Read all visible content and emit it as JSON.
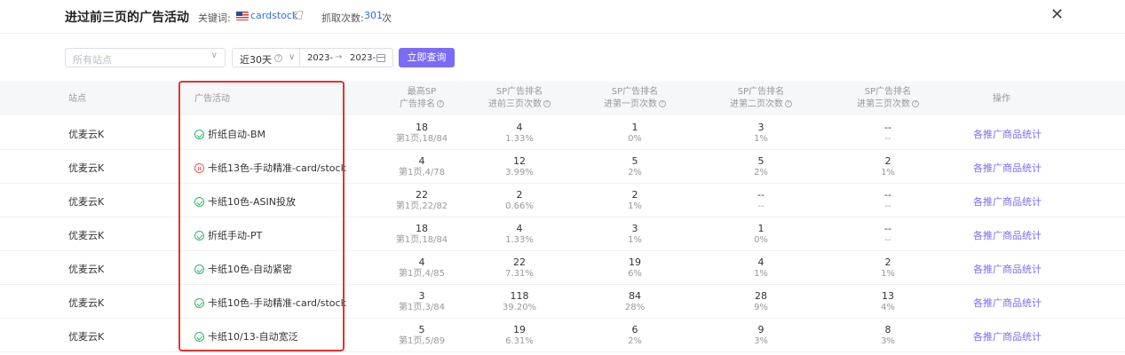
{
  "header": {
    "title": "进过前三页的广告活动",
    "keyword_label": "关键词:",
    "keyword_value": "cardstock",
    "count_label": "抓取次数:",
    "count_value": "301",
    "count_unit": "次"
  },
  "filters": {
    "site_placeholder": "所有站点",
    "range_selected": "近30天",
    "date_start": "2023-",
    "date_arrow": "→",
    "date_end": "2023-",
    "query_button": "立即查询"
  },
  "columns": {
    "site": "站点",
    "campaign": "广告活动",
    "top_rank_1": "最高SP",
    "top_rank_2": "广告排名",
    "top3_1": "SP广告排名",
    "top3_2": "进前三页次数",
    "p1_1": "SP广告排名",
    "p1_2": "进第一页次数",
    "p2_1": "SP广告排名",
    "p2_2": "进第二页次数",
    "p3_1": "SP广告排名",
    "p3_2": "进第三页次数",
    "action": "操作"
  },
  "rows": [
    {
      "site": "优麦云K",
      "status": "active",
      "campaign": "折纸自动-BM",
      "best": "18",
      "best_sub": "第1页,18/84",
      "top3": "4",
      "top3_pct": "1.33%",
      "p1": "1",
      "p1_pct": "0%",
      "p2": "3",
      "p2_pct": "1%",
      "p3": "--",
      "p3_pct": "--",
      "action": "各推广商品统计"
    },
    {
      "site": "优麦云K",
      "status": "paused",
      "campaign": "卡纸13色-手动精准-card/stock",
      "best": "4",
      "best_sub": "第1页,4/78",
      "top3": "12",
      "top3_pct": "3.99%",
      "p1": "5",
      "p1_pct": "2%",
      "p2": "5",
      "p2_pct": "2%",
      "p3": "2",
      "p3_pct": "1%",
      "action": "各推广商品统计"
    },
    {
      "site": "优麦云K",
      "status": "active",
      "campaign": "卡纸10色-ASIN投放",
      "best": "22",
      "best_sub": "第1页,22/82",
      "top3": "2",
      "top3_pct": "0.66%",
      "p1": "2",
      "p1_pct": "1%",
      "p2": "--",
      "p2_pct": "--",
      "p3": "--",
      "p3_pct": "--",
      "action": "各推广商品统计"
    },
    {
      "site": "优麦云K",
      "status": "active",
      "campaign": "折纸手动-PT",
      "best": "18",
      "best_sub": "第1页,18/84",
      "top3": "4",
      "top3_pct": "1.33%",
      "p1": "3",
      "p1_pct": "1%",
      "p2": "1",
      "p2_pct": "0%",
      "p3": "--",
      "p3_pct": "--",
      "action": "各推广商品统计"
    },
    {
      "site": "优麦云K",
      "status": "active",
      "campaign": "卡纸10色-自动紧密",
      "best": "4",
      "best_sub": "第1页,4/85",
      "top3": "22",
      "top3_pct": "7.31%",
      "p1": "19",
      "p1_pct": "6%",
      "p2": "4",
      "p2_pct": "1%",
      "p3": "2",
      "p3_pct": "1%",
      "action": "各推广商品统计"
    },
    {
      "site": "优麦云K",
      "status": "active",
      "campaign": "卡纸10色-手动精准-card/stock",
      "best": "3",
      "best_sub": "第1页,3/84",
      "top3": "118",
      "top3_pct": "39.20%",
      "p1": "84",
      "p1_pct": "28%",
      "p2": "28",
      "p2_pct": "9%",
      "p3": "13",
      "p3_pct": "4%",
      "action": "各推广商品统计"
    },
    {
      "site": "优麦云K",
      "status": "active",
      "campaign": "卡纸10/13-自动宽泛",
      "best": "5",
      "best_sub": "第1页,5/89",
      "top3": "19",
      "top3_pct": "6.31%",
      "p1": "6",
      "p1_pct": "2%",
      "p2": "9",
      "p2_pct": "3%",
      "p3": "8",
      "p3_pct": "3%",
      "action": "各推广商品统计"
    }
  ],
  "colors": {
    "accent": "#7b6cf6",
    "link": "#2f6fd6",
    "status_active": "#2fb871",
    "status_paused": "#e85a5a",
    "highlight": "#e3342f"
  }
}
